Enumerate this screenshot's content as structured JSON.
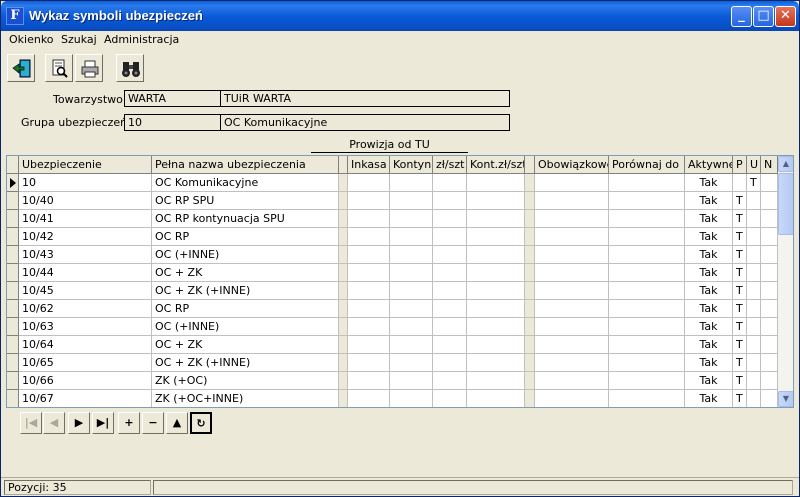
{
  "window": {
    "title": "Wykaz symboli ubezpieczeń",
    "app_icon_glyph": "F",
    "buttons": {
      "minimize": "_",
      "maximize": "□",
      "close": "✕"
    }
  },
  "menu": [
    "Okienko",
    "Szukaj",
    "Administracja"
  ],
  "toolbar": {
    "icons": [
      "exit-door-icon",
      "print-preview-icon",
      "printer-icon",
      "binoculars-icon"
    ]
  },
  "form": {
    "towarzystwo_label": "Towarzystwo",
    "towarzystwo_code": "WARTA",
    "towarzystwo_name": "TUiR WARTA",
    "grupa_label": "Grupa ubezpieczeń",
    "grupa_code": "10",
    "grupa_name": "OC Komunikacyjne"
  },
  "prowizja_label": "Prowizja od TU",
  "grid": {
    "columns": [
      "Ubezpieczenie",
      "Pełna nazwa ubezpieczenia",
      "",
      "Inkasa",
      "Kontyn.",
      "zł/szt",
      "Kont.zł/szt",
      "",
      "Obowiązkowe",
      "Porównaj do",
      "Aktywne",
      "P",
      "U",
      "N"
    ],
    "rows": [
      {
        "code": "10",
        "name": "OC Komunikacyjne",
        "aktywne": "Tak",
        "p": "",
        "u": "T",
        "current": true
      },
      {
        "code": "10/40",
        "name": "OC RP SPU",
        "aktywne": "Tak",
        "p": "T",
        "u": ""
      },
      {
        "code": "10/41",
        "name": "OC RP kontynuacja SPU",
        "aktywne": "Tak",
        "p": "T",
        "u": ""
      },
      {
        "code": "10/42",
        "name": "OC RP",
        "aktywne": "Tak",
        "p": "T",
        "u": ""
      },
      {
        "code": "10/43",
        "name": "OC (+INNE)",
        "aktywne": "Tak",
        "p": "T",
        "u": ""
      },
      {
        "code": "10/44",
        "name": "OC + ZK",
        "aktywne": "Tak",
        "p": "T",
        "u": ""
      },
      {
        "code": "10/45",
        "name": "OC + ZK (+INNE)",
        "aktywne": "Tak",
        "p": "T",
        "u": ""
      },
      {
        "code": "10/62",
        "name": "OC RP",
        "aktywne": "Tak",
        "p": "T",
        "u": ""
      },
      {
        "code": "10/63",
        "name": "OC (+INNE)",
        "aktywne": "Tak",
        "p": "T",
        "u": ""
      },
      {
        "code": "10/64",
        "name": "OC + ZK",
        "aktywne": "Tak",
        "p": "T",
        "u": ""
      },
      {
        "code": "10/65",
        "name": "OC + ZK (+INNE)",
        "aktywne": "Tak",
        "p": "T",
        "u": ""
      },
      {
        "code": "10/66",
        "name": "ZK (+OC)",
        "aktywne": "Tak",
        "p": "T",
        "u": ""
      },
      {
        "code": "10/67",
        "name": "ZK (+OC+INNE)",
        "aktywne": "Tak",
        "p": "T",
        "u": ""
      }
    ]
  },
  "navigator": [
    "|◀",
    "◀",
    "▶",
    "▶|",
    "+",
    "−",
    "▲",
    "↻"
  ],
  "status": {
    "pozycji": "Pozycji: 35"
  }
}
